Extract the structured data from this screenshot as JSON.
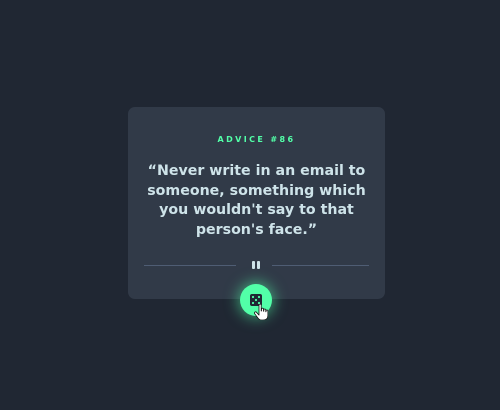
{
  "advice": {
    "id_label": "ADVICE #86",
    "quote": "“Never write in an email to someone, something which you wouldn't say to that person's face.”"
  },
  "divider": {
    "icon": "pause-icon"
  },
  "button": {
    "icon": "dice-icon"
  },
  "cursor": {
    "icon": "hand-pointer-icon"
  },
  "colors": {
    "background": "#202733",
    "card": "#313a48",
    "accent": "#52ffa8",
    "text": "#cee3e9",
    "divider": "#4f5d74"
  }
}
